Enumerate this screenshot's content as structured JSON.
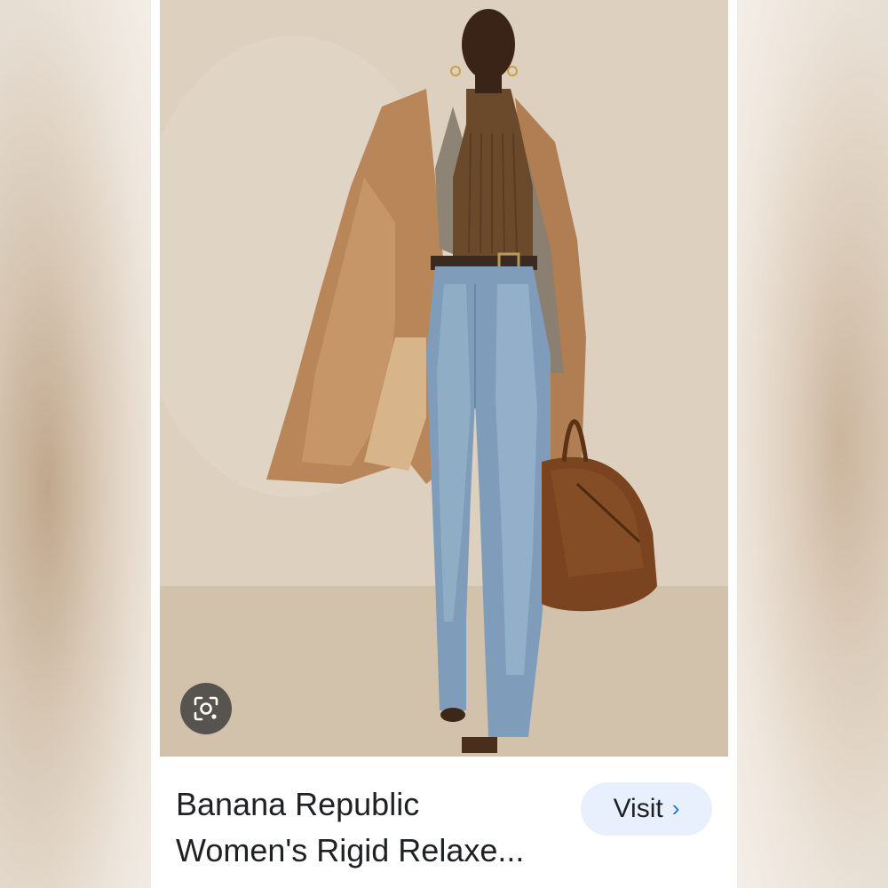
{
  "result_card": {
    "title_line1": "Banana Republic",
    "title_line2": "Women's Rigid Relaxe...",
    "visit_label": "Visit",
    "visit_chevron": "›"
  },
  "icons": {
    "lens": "google-lens-icon",
    "chevron": "chevron-right-icon"
  },
  "colors": {
    "visit_bg": "#e8f0fe",
    "chevron": "#1a73e8",
    "text": "#202124"
  }
}
